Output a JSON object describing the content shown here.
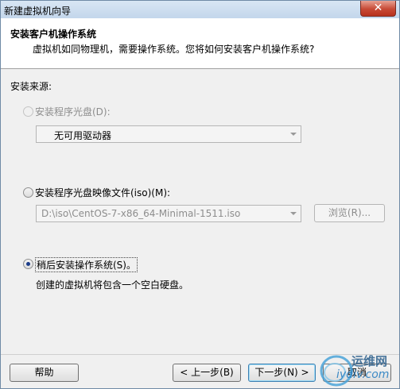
{
  "window": {
    "title": "新建虚拟机向导",
    "close_glyph": "✕"
  },
  "header": {
    "title": "安装客户机操作系统",
    "subtitle": "虚拟机如同物理机，需要操作系统。您将如何安装客户机操作系统?"
  },
  "install_source_label": "安装来源:",
  "options": {
    "disc": {
      "label": "安装程序光盘(D):",
      "selected": false,
      "enabled": false,
      "drive_value": "无可用驱动器"
    },
    "iso": {
      "label": "安装程序光盘映像文件(iso)(M):",
      "selected": false,
      "enabled": true,
      "path_value": "D:\\iso\\CentOS-7-x86_64-Minimal-1511.iso",
      "browse_label": "浏览(R)..."
    },
    "later": {
      "label": "稍后安装操作系统(S)。",
      "selected": true,
      "enabled": true,
      "description": "创建的虚拟机将包含一个空白硬盘。"
    }
  },
  "buttons": {
    "help": "帮助",
    "back": "< 上一步(B)",
    "next": "下一步(N) >",
    "cancel": "取消"
  },
  "watermark": {
    "text": "运维网",
    "site": "iydiv.com"
  }
}
